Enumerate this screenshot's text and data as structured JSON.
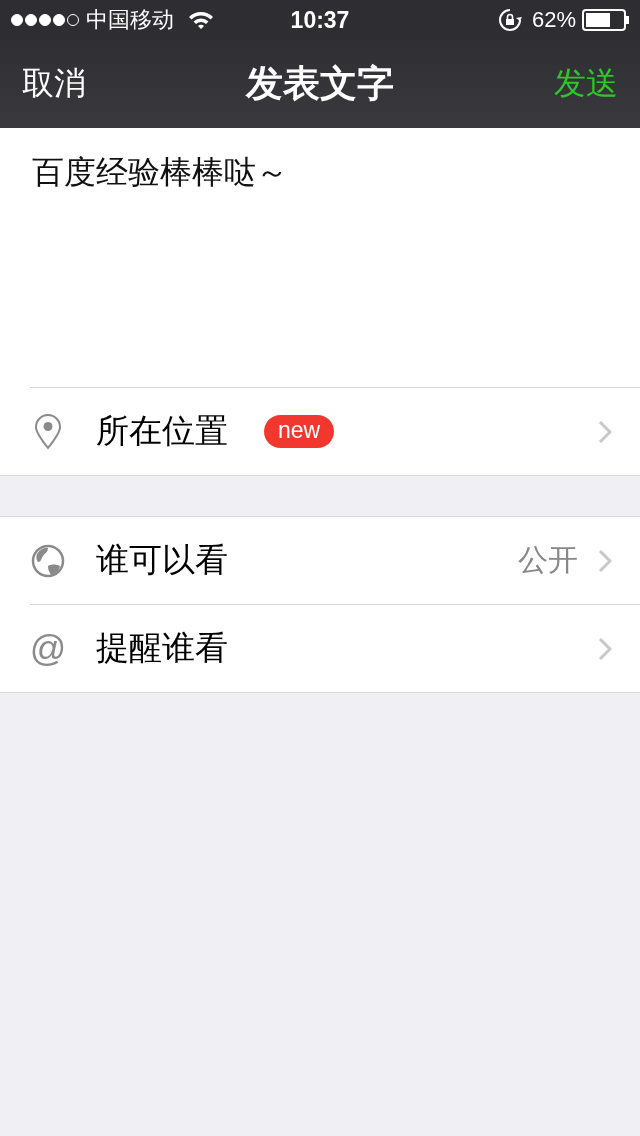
{
  "status_bar": {
    "carrier": "中国移动",
    "time": "10:37",
    "battery": "62%"
  },
  "nav": {
    "cancel": "取消",
    "title": "发表文字",
    "send": "发送"
  },
  "post": {
    "text": "百度经验棒棒哒～"
  },
  "sections": [
    {
      "rows": [
        {
          "kind": "location",
          "label": "所在位置",
          "badge": "new"
        }
      ]
    },
    {
      "rows": [
        {
          "kind": "globe",
          "label": "谁可以看",
          "value": "公开"
        },
        {
          "kind": "at",
          "icon": "@",
          "label": "提醒谁看"
        }
      ]
    }
  ]
}
